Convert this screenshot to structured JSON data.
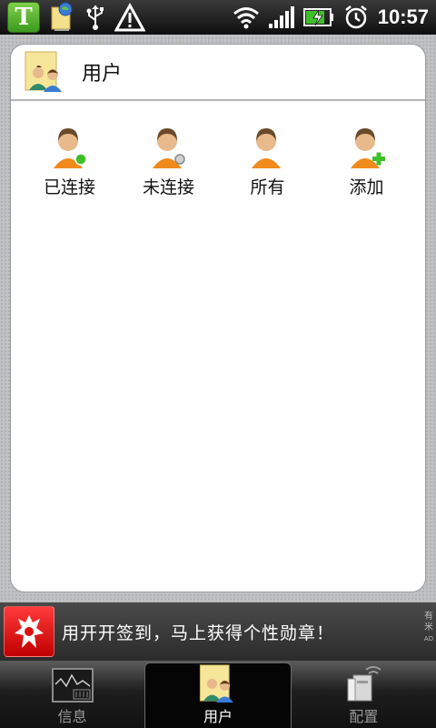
{
  "status_bar": {
    "app_icon_letter": "T",
    "icons": [
      "globe-app-icon",
      "usb-icon",
      "warning-icon",
      "wifi-icon",
      "signal-icon",
      "battery-charging-icon",
      "alarm-icon"
    ],
    "time": "10:57"
  },
  "panel": {
    "title": "用户",
    "actions": [
      {
        "label": "已连接",
        "badge": "connected-dot-icon"
      },
      {
        "label": "未连接",
        "badge": "disconnected-dot-icon"
      },
      {
        "label": "所有",
        "badge": ""
      },
      {
        "label": "添加",
        "badge": "plus-icon"
      }
    ]
  },
  "ad": {
    "text": "用开开签到，马上获得个性勋章！",
    "mark": [
      "有",
      "米",
      "AD"
    ]
  },
  "tabs": [
    {
      "label": "信息",
      "icon": "monitor-chart-icon",
      "active": false
    },
    {
      "label": "用户",
      "icon": "users-icon",
      "active": true
    },
    {
      "label": "配置",
      "icon": "router-config-icon",
      "active": false
    }
  ],
  "colors": {
    "accent_green": "#3fbf2a",
    "ad_red": "#d81010"
  }
}
